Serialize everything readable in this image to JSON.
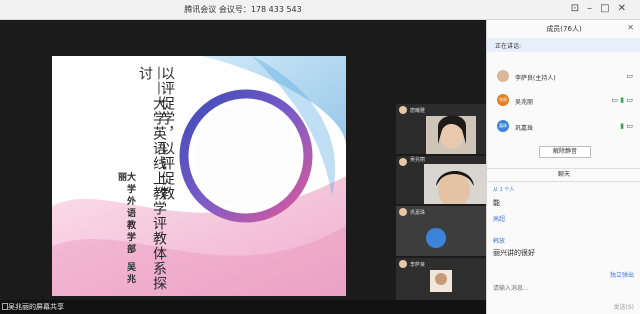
{
  "window": {
    "title": "腾讯会议  会议号：178 433 543"
  },
  "slide": {
    "title_line1": "以评促学，以评促教",
    "title_line2": "——大学英语线上教学评教体系探讨",
    "subtitle": "大学外语教学部  吴兆丽"
  },
  "videos": [
    {
      "name": "唐曦雅",
      "label": ""
    },
    {
      "name": "吴兆丽",
      "label": ""
    },
    {
      "name": "巩嘉珠",
      "label": ""
    },
    {
      "name": "李萨良",
      "label": "主持"
    }
  ],
  "bottombar": {
    "share_label": "吴兆丽的屏幕共享"
  },
  "panel": {
    "members_title": "成员(76人)",
    "speaking_label": "正在讲话:",
    "members": [
      {
        "name": "李萨良(主持人)",
        "avatar": ""
      },
      {
        "name": "吴兆丽",
        "avatar": "兆丽"
      },
      {
        "name": "巩嘉珠",
        "avatar": "嘉珠"
      }
    ],
    "unmute_all": "解除静音",
    "chat_title": "聊天",
    "chat": [
      {
        "type": "sys",
        "text": "从 1 个人"
      },
      {
        "type": "line",
        "text": "能"
      },
      {
        "type": "name",
        "text": "高超"
      },
      {
        "type": "name",
        "text": "韩放"
      },
      {
        "type": "line",
        "text": "丽兴讲的很好"
      }
    ],
    "chat_link": "独立弹出",
    "chat_placeholder": "请输入消息...",
    "send_label": "发送(S)"
  },
  "colors": {
    "accent": "#3a7bd5",
    "mic_on": "#2fa84f"
  },
  "icons": [
    "expand-icon",
    "close-icon",
    "microphone-icon",
    "camera-icon"
  ]
}
